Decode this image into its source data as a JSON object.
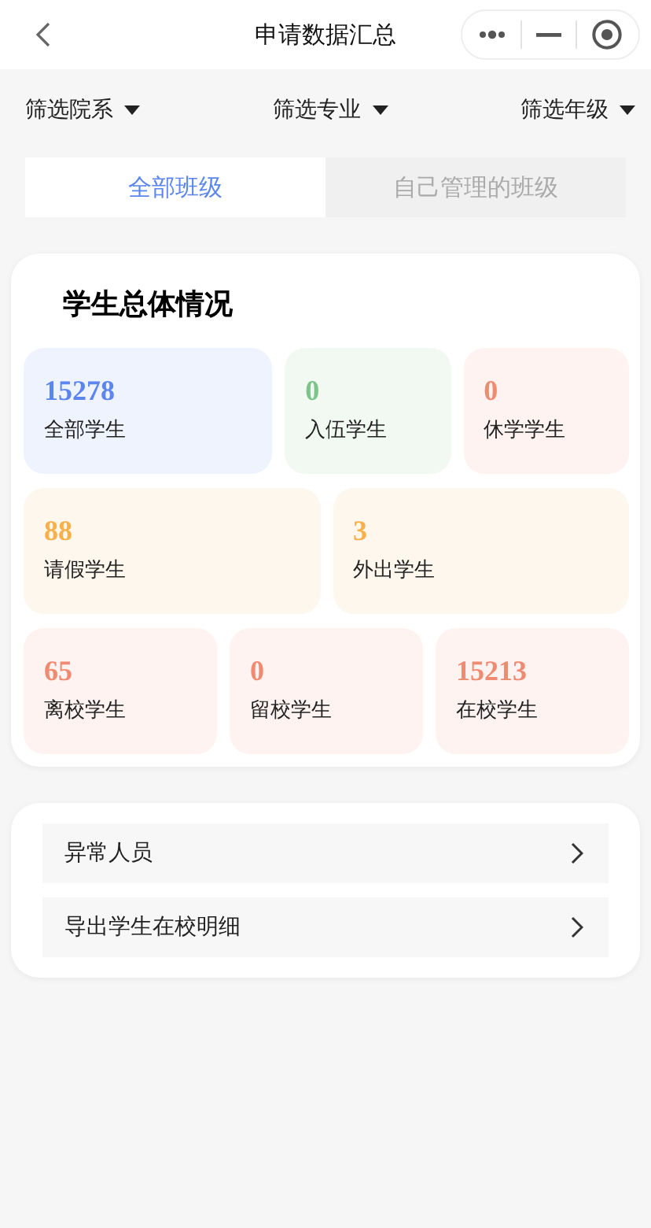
{
  "nav": {
    "title": "申请数据汇总"
  },
  "filters": [
    {
      "label": "筛选院系"
    },
    {
      "label": "筛选专业"
    },
    {
      "label": "筛选年级"
    }
  ],
  "tabs": [
    {
      "label": "全部班级",
      "selected": true
    },
    {
      "label": "自己管理的班级",
      "selected": false
    }
  ],
  "overview": {
    "title": "学生总体情况",
    "rows": [
      [
        {
          "value": "15278",
          "label": "全部学生",
          "color": "#5b86f0"
        },
        {
          "value": "0",
          "label": "入伍学生",
          "color": "#7cc48a"
        },
        {
          "value": "0",
          "label": "休学学生",
          "color": "#f08a70"
        }
      ],
      [
        {
          "value": "88",
          "label": "请假学生",
          "color": "#f9b04a"
        },
        {
          "value": "3",
          "label": "外出学生",
          "color": "#f9b04a"
        }
      ],
      [
        {
          "value": "65",
          "label": "离校学生",
          "color": "#f08a70"
        },
        {
          "value": "0",
          "label": "留校学生",
          "color": "#f08a70"
        },
        {
          "value": "15213",
          "label": "在校学生",
          "color": "#f08a70"
        }
      ]
    ]
  },
  "links": [
    {
      "label": "异常人员"
    },
    {
      "label": "导出学生在校明细"
    }
  ]
}
